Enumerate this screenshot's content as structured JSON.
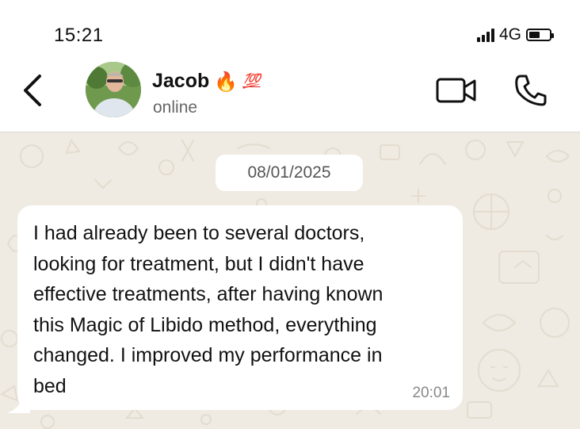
{
  "status_bar": {
    "time": "15:21",
    "network": "4G",
    "battery_level": 0.55,
    "signal_bars": 4
  },
  "header": {
    "contact_name": "Jacob",
    "name_emojis": [
      "🔥",
      "💯"
    ],
    "status": "online",
    "icons": [
      "back-chevron-icon",
      "video-camera-icon",
      "phone-icon"
    ]
  },
  "chat": {
    "date_chip": "08/01/2025",
    "messages": [
      {
        "direction": "incoming",
        "text": "I had already been to several doctors,\nlooking for treatment, but I didn't have\neffective treatments, after having known\nthis Magic of Libido method, everything\nchanged. I improved my performance in\nbed",
        "time": "20:01"
      }
    ]
  },
  "colors": {
    "chat_background": "#efeae2",
    "bubble": "#ffffff",
    "header_background": "#ffffff",
    "muted_text": "#666666"
  }
}
